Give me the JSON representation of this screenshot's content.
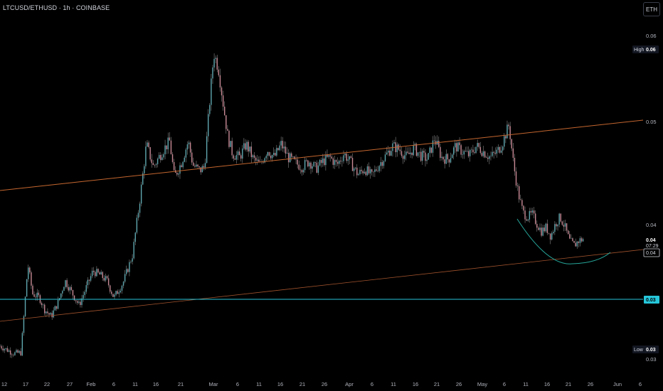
{
  "header": {
    "title": "LTCUSD/ETHUSD · 1h · COINBASE",
    "currency_button": "ETH"
  },
  "colors": {
    "background": "#000000",
    "candle_up": "#5fa8b0",
    "candle_down": "#c98a96",
    "wick": "#c9c9c9",
    "trend_upper": "#c4662f",
    "trend_lower": "#a0522d",
    "horizontal": "#26c6da",
    "arc": "#26a69a",
    "high_box": "#131722",
    "low_box": "#131722"
  },
  "icons": {
    "currency": "eth-currency-toggle"
  },
  "chart_data": {
    "type": "candlestick",
    "title": "LTCUSD/ETHUSD · 1h · COINBASE",
    "x_tick_labels": [
      "12",
      "17",
      "22",
      "27",
      "Feb",
      "6",
      "11",
      "16",
      "21",
      "Mar",
      "6",
      "11",
      "16",
      "21",
      "26",
      "Apr",
      "6",
      "11",
      "16",
      "21",
      "26",
      "May",
      "6",
      "11",
      "16",
      "21",
      "26",
      "Jun",
      "6"
    ],
    "y_tick_labels": [
      "0.06",
      "0.05",
      "0.04",
      "0.03"
    ],
    "ylim": [
      0.0254,
      0.0629
    ],
    "price_path": [
      [
        0.0,
        0.0279
      ],
      [
        1.5,
        0.0275
      ],
      [
        3.0,
        0.0271
      ],
      [
        4.5,
        0.0272
      ],
      [
        5.0,
        0.0302
      ],
      [
        6.0,
        0.0365
      ],
      [
        7.0,
        0.0334
      ],
      [
        8.5,
        0.033
      ],
      [
        9.5,
        0.0318
      ],
      [
        11.0,
        0.031
      ],
      [
        12.5,
        0.0325
      ],
      [
        14.0,
        0.0348
      ],
      [
        15.5,
        0.0335
      ],
      [
        17.0,
        0.0322
      ],
      [
        18.5,
        0.034
      ],
      [
        20.0,
        0.0358
      ],
      [
        21.5,
        0.0354
      ],
      [
        23.0,
        0.0348
      ],
      [
        24.5,
        0.033
      ],
      [
        26.5,
        0.0346
      ],
      [
        28.5,
        0.0375
      ],
      [
        30.0,
        0.043
      ],
      [
        31.5,
        0.0492
      ],
      [
        33.0,
        0.0468
      ],
      [
        35.0,
        0.0485
      ],
      [
        36.5,
        0.0495
      ],
      [
        37.5,
        0.0457
      ],
      [
        39.0,
        0.0472
      ],
      [
        40.5,
        0.0495
      ],
      [
        41.5,
        0.047
      ],
      [
        43.0,
        0.0464
      ],
      [
        44.0,
        0.0468
      ],
      [
        45.0,
        0.053
      ],
      [
        46.0,
        0.0588
      ],
      [
        47.0,
        0.0572
      ],
      [
        48.0,
        0.0535
      ],
      [
        49.0,
        0.05
      ],
      [
        50.0,
        0.0482
      ],
      [
        51.5,
        0.0478
      ],
      [
        53.0,
        0.0492
      ],
      [
        54.5,
        0.0476
      ],
      [
        56.0,
        0.047
      ],
      [
        57.5,
        0.0486
      ],
      [
        59.0,
        0.0478
      ],
      [
        60.5,
        0.0492
      ],
      [
        62.0,
        0.0478
      ],
      [
        63.5,
        0.0472
      ],
      [
        65.0,
        0.0468
      ],
      [
        66.5,
        0.0474
      ],
      [
        68.0,
        0.0466
      ],
      [
        69.5,
        0.0474
      ],
      [
        71.0,
        0.0478
      ],
      [
        72.5,
        0.047
      ],
      [
        74.0,
        0.0482
      ],
      [
        75.5,
        0.0472
      ],
      [
        77.0,
        0.046
      ],
      [
        78.5,
        0.0466
      ],
      [
        80.0,
        0.0458
      ],
      [
        81.5,
        0.047
      ],
      [
        83.0,
        0.048
      ],
      [
        84.5,
        0.049
      ],
      [
        86.0,
        0.0486
      ],
      [
        87.5,
        0.0478
      ],
      [
        89.0,
        0.0488
      ],
      [
        90.5,
        0.048
      ],
      [
        92.0,
        0.0476
      ],
      [
        93.5,
        0.0498
      ],
      [
        95.0,
        0.0478
      ],
      [
        96.5,
        0.0476
      ],
      [
        98.0,
        0.049
      ],
      [
        99.5,
        0.0484
      ],
      [
        101.0,
        0.048
      ],
      [
        102.5,
        0.049
      ],
      [
        104.0,
        0.0484
      ],
      [
        105.5,
        0.0478
      ],
      [
        107.0,
        0.0484
      ],
      [
        108.0,
        0.0492
      ],
      [
        109.5,
        0.0512
      ],
      [
        110.5,
        0.047
      ],
      [
        111.5,
        0.044
      ],
      [
        112.5,
        0.042
      ],
      [
        113.5,
        0.0415
      ],
      [
        114.5,
        0.0418
      ],
      [
        115.5,
        0.0408
      ],
      [
        116.5,
        0.04
      ],
      [
        117.5,
        0.0404
      ],
      [
        118.5,
        0.0395
      ],
      [
        119.5,
        0.0408
      ],
      [
        120.5,
        0.0415
      ],
      [
        121.5,
        0.0405
      ],
      [
        122.5,
        0.039
      ],
      [
        123.5,
        0.0385
      ],
      [
        124.5,
        0.039
      ],
      [
        125.5,
        0.0392
      ]
    ],
    "high_label": "High",
    "high_value": "0.06",
    "low_label": "Low",
    "low_value": "0.03",
    "last_price": "0.04",
    "countdown": "07:29",
    "trend_label_value": "0.04",
    "horizontal_label_value": "0.03",
    "grid": false
  }
}
